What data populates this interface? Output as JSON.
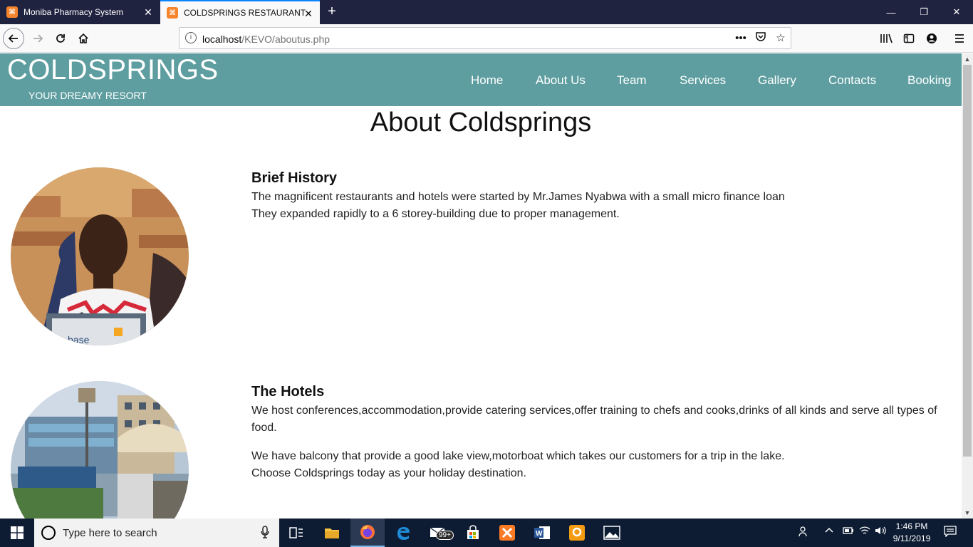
{
  "browser": {
    "tabs": [
      {
        "title": "Moniba Pharmacy System"
      },
      {
        "title": "COLDSPRINGS RESTAURANT"
      }
    ],
    "url_host": "localhost",
    "url_path": "/KEVO/aboutus.php",
    "favicon_glyph": "⌘"
  },
  "site": {
    "brand": "COLDSPRINGS",
    "tagline": "YOUR DREAMY RESORT",
    "nav": [
      "Home",
      "About Us",
      "Team",
      "Services",
      "Gallery",
      "Contacts",
      "Booking"
    ],
    "page_heading": "About Coldsprings",
    "sections": [
      {
        "title": "Brief History",
        "lines": [
          "The magnificent restaurants and hotels were started by Mr.James Nyabwa with a small micro finance loan",
          "They expanded rapidly to a 6 storey-building due to proper management."
        ]
      },
      {
        "title": "The Hotels",
        "lines": [
          "We host conferences,accommodation,provide catering services,offer training to chefs and cooks,drinks of all kinds and serve all types of food.",
          "We have balcony that provide a good lake view,motorboat which takes our customers for a trip in the lake.",
          "Choose Coldsprings today as your holiday destination."
        ]
      }
    ],
    "photo_text": "base"
  },
  "taskbar": {
    "search_placeholder": "Type here to search",
    "mail_badge": "99+",
    "time": "1:46 PM",
    "date": "9/11/2019"
  },
  "colors": {
    "header_bg": "#5f9ea0",
    "tab_accent": "#0a84ff",
    "taskbar_bg": "#0d1c33"
  }
}
